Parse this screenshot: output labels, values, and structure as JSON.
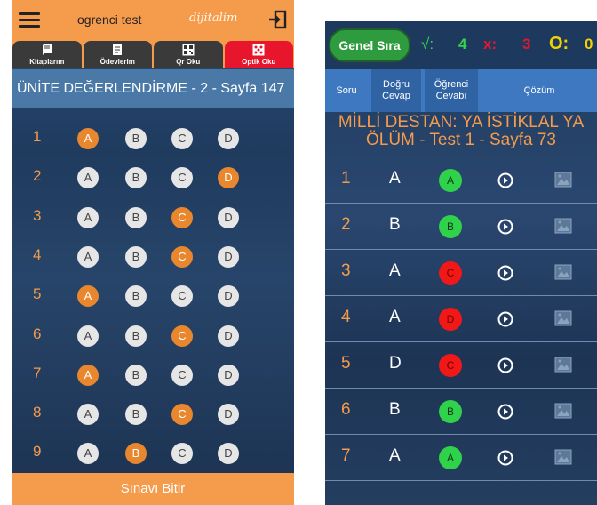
{
  "left": {
    "header": {
      "title": "ogrenci test",
      "logo": "dijitalim"
    },
    "tabs": [
      {
        "label": "Kitaplarım",
        "icon": "book-icon"
      },
      {
        "label": "Ödevlerim",
        "icon": "homework-icon"
      },
      {
        "label": "Qr Oku",
        "icon": "qr-icon"
      },
      {
        "label": "Optik Oku",
        "icon": "optic-icon",
        "active": true
      }
    ],
    "heading": "ÜNİTE DEĞERLENDİRME - 2 - Sayfa 147",
    "options": [
      "A",
      "B",
      "C",
      "D"
    ],
    "questions": [
      {
        "num": "1",
        "selected": "A"
      },
      {
        "num": "2",
        "selected": "D"
      },
      {
        "num": "3",
        "selected": "C"
      },
      {
        "num": "4",
        "selected": "C"
      },
      {
        "num": "5",
        "selected": "A"
      },
      {
        "num": "6",
        "selected": "C"
      },
      {
        "num": "7",
        "selected": "A"
      },
      {
        "num": "8",
        "selected": "C"
      },
      {
        "num": "9",
        "selected": "B"
      }
    ],
    "finish_button": "Sınavı Bitir"
  },
  "right": {
    "rank_button": "Genel Sıra",
    "correct": {
      "symbol": "√:",
      "count": "4"
    },
    "wrong": {
      "symbol": "x:",
      "count": "3"
    },
    "blank": {
      "symbol": "O:",
      "count": "0"
    },
    "columns": [
      "Soru",
      "Doğru Cevap",
      "Öğrenci Cevabı",
      "Çözüm"
    ],
    "title": "MİLLİ DESTAN: YA İSTİKLAL YA ÖLÜM - Test 1 - Sayfa 73",
    "answers": [
      {
        "num": "1",
        "correct": "A",
        "student": "A",
        "status": "correct"
      },
      {
        "num": "2",
        "correct": "B",
        "student": "B",
        "status": "correct"
      },
      {
        "num": "3",
        "correct": "A",
        "student": "C",
        "status": "wrong"
      },
      {
        "num": "4",
        "correct": "A",
        "student": "D",
        "status": "wrong"
      },
      {
        "num": "5",
        "correct": "D",
        "student": "C",
        "status": "wrong"
      },
      {
        "num": "6",
        "correct": "B",
        "student": "B",
        "status": "correct"
      },
      {
        "num": "7",
        "correct": "A",
        "student": "A",
        "status": "correct"
      }
    ]
  },
  "colors": {
    "orange": "#f59b4c",
    "selected_option": "#e8872e",
    "active_tab": "#e8162c",
    "correct_green": "#2fd24a",
    "wrong_red": "#f21818",
    "blue_header": "#3d78c0"
  }
}
